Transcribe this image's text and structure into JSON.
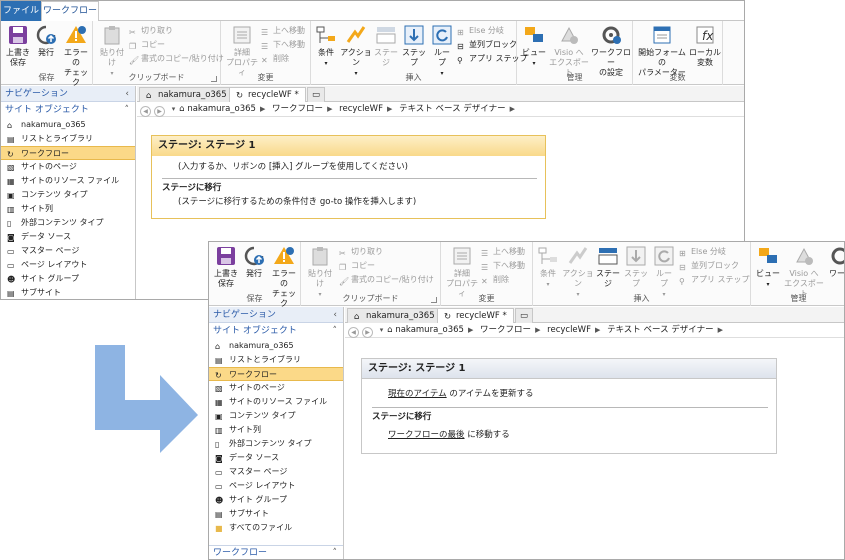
{
  "tabs": {
    "file": "ファイル",
    "workflow": "ワークフロー"
  },
  "ribbon": {
    "save": [
      "上書き",
      "保存"
    ],
    "publish": "発行",
    "check": [
      "エラーの",
      "チェック"
    ],
    "paste": "貼り付け",
    "cut": "切り取り",
    "copy": "コピー",
    "format_paint": "書式のコピー/貼り付け",
    "details": [
      "詳細",
      "プロパティ"
    ],
    "move_up": "上へ移動",
    "move_down": "下へ移動",
    "delete": "削除",
    "condition": "条件",
    "action": "アクション",
    "stage": [
      "ステー",
      "ジ"
    ],
    "step": "ステップ",
    "loop": "ループ",
    "else_branch": "Else 分岐",
    "parallel": "並列ブロック",
    "app_step": "アプリ ステップ",
    "view": "ビュー",
    "visio_export": [
      "Visio へ",
      "エクスポート"
    ],
    "wf_settings": [
      "ワークフロー",
      "の設定"
    ],
    "wf_settings_cut": "ワー",
    "init_form": [
      "開始フォームの",
      "パラメーター"
    ],
    "local_vars": [
      "ローカル",
      "変数"
    ],
    "groups": {
      "save": "保存",
      "clipboard": "クリップボード",
      "modify": "変更",
      "insert": "挿入",
      "manage": "管理",
      "variables": "変数"
    }
  },
  "nav": {
    "header": "ナビゲーション",
    "section": "サイト オブジェクト",
    "items": [
      "nakamura_o365",
      "リストとライブラリ",
      "ワークフロー",
      "サイトのページ",
      "サイトのリソース ファイル",
      "コンテンツ タイプ",
      "サイト列",
      "外部コンテンツ タイプ",
      "データ ソース",
      "マスター ページ",
      "ページ レイアウト",
      "サイト グループ",
      "サブサイト",
      "すべてのファイル"
    ],
    "footer": "ワークフロー"
  },
  "doctabs": {
    "site": "nakamura_o365",
    "doc": "recycleWF *"
  },
  "breadcrumb": [
    "nakamura_o365",
    "ワークフロー",
    "recycleWF",
    "テキスト ベース デザイナー"
  ],
  "back_card": {
    "title": "ステージ: ステージ 1",
    "body": "(入力するか、リボンの [挿入] グループを使用してください)",
    "transition_title": "ステージに移行",
    "transition_body": "(ステージに移行するための条件付き go-to 操作を挿入します)"
  },
  "front_card": {
    "title": "ステージ: ステージ 1",
    "action_link": "現在のアイテム",
    "action_rest": " のアイテムを更新する",
    "transition_title": "ステージに移行",
    "goto_link": "ワークフローの最後",
    "goto_rest": " に移動する"
  },
  "colors": {
    "accent": "#2d6fb3",
    "selection": "#fbd988",
    "arrow": "#8eb4e3"
  }
}
